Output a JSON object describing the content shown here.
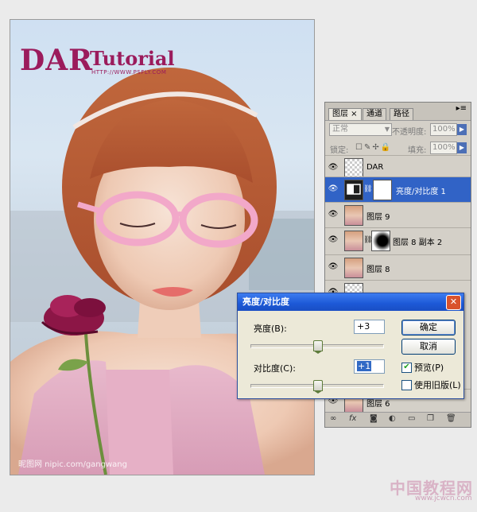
{
  "photo": {
    "logo_dar": "DAR",
    "logo_tutorial": "Tutorial",
    "logo_url": "HTTP://WWW.PSFLY.COM",
    "watermark_left": "昵图网 nipic.com/gangwang",
    "watermark_right": "中国教程网",
    "watermark_right_url": "www.jcwcn.com"
  },
  "layers_panel": {
    "tabs": [
      {
        "label": "图层 ×"
      },
      {
        "label": "通道"
      },
      {
        "label": "路径"
      }
    ],
    "menu_icon": "panel-menu-icon",
    "blend_mode": "正常",
    "opacity_label": "不透明度:",
    "opacity_value": "100%",
    "lock_label": "锁定:",
    "fill_label": "填充:",
    "fill_value": "100%",
    "layers": [
      {
        "name": "DAR",
        "selected": false
      },
      {
        "name": "亮度/对比度 1",
        "selected": true
      },
      {
        "name": "图层 9",
        "selected": false
      },
      {
        "name": "图层 8 副本 2",
        "selected": false
      },
      {
        "name": "图层 8",
        "selected": false
      },
      {
        "name": "图层 6",
        "selected": false
      }
    ],
    "bottom_icons": [
      "link-icon",
      "fx-icon",
      "mask-icon",
      "adjustment-icon",
      "folder-icon",
      "new-layer-icon",
      "trash-icon"
    ]
  },
  "dialog": {
    "title": "亮度/对比度",
    "brightness_label": "亮度(B):",
    "brightness_value": "+3",
    "contrast_label": "对比度(C):",
    "contrast_value": "+1",
    "ok_label": "确定",
    "cancel_label": "取消",
    "preview_label": "预览(P)",
    "preview_checked": true,
    "legacy_label": "使用旧版(L)",
    "legacy_checked": false,
    "brightness_slider": 0.5,
    "contrast_slider": 0.5
  }
}
